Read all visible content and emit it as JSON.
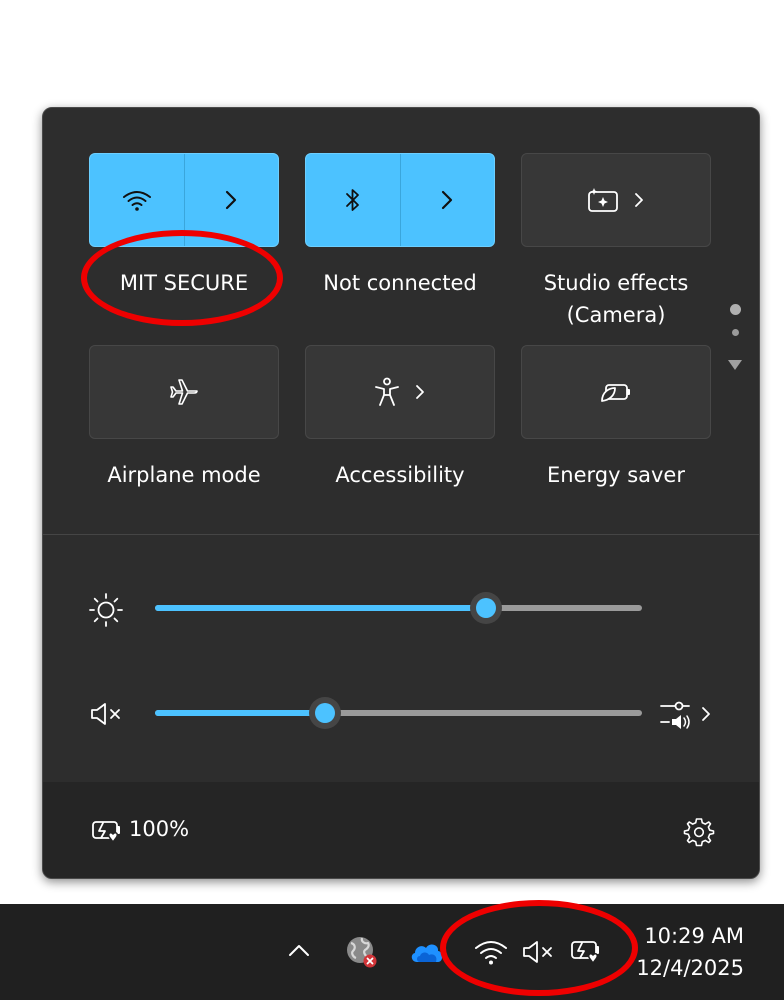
{
  "quick_settings": {
    "tiles": [
      {
        "label": "MIT SECURE",
        "icon": "wifi-icon",
        "state": "on",
        "expandable": true
      },
      {
        "label": "Not connected",
        "icon": "bluetooth-icon",
        "state": "on",
        "expandable": true
      },
      {
        "label": "Studio effects",
        "label2": "(Camera)",
        "icon": "studio-effects-icon",
        "state": "off",
        "expandable": true
      },
      {
        "label": "Airplane mode",
        "icon": "airplane-icon",
        "state": "off",
        "expandable": false
      },
      {
        "label": "Accessibility",
        "icon": "accessibility-icon",
        "state": "off",
        "expandable": true
      },
      {
        "label": "Energy saver",
        "icon": "energy-saver-icon",
        "state": "off",
        "expandable": false
      }
    ],
    "page_indicator": {
      "pages": 2,
      "current": 1
    },
    "brightness": {
      "icon": "brightness-icon",
      "level_percent": 68
    },
    "volume": {
      "icon": "volume-muted-icon",
      "level_percent": 35,
      "muted": true,
      "mixer_icon": "volume-mixer-icon"
    },
    "footer": {
      "battery_icon": "battery-saver-icon",
      "battery_text": "100%",
      "settings_icon": "gear-icon"
    }
  },
  "taskbar": {
    "tray_icons": [
      "chevron-up-icon",
      "vpn-globe-icon",
      "onedrive-icon",
      "wifi-icon",
      "volume-muted-icon",
      "battery-icon"
    ],
    "time": "10:29 AM",
    "date": "12/4/2025"
  },
  "colors": {
    "accent": "#4cc2ff",
    "panel": "#2d2d2d",
    "annotation": "#ee0000"
  }
}
